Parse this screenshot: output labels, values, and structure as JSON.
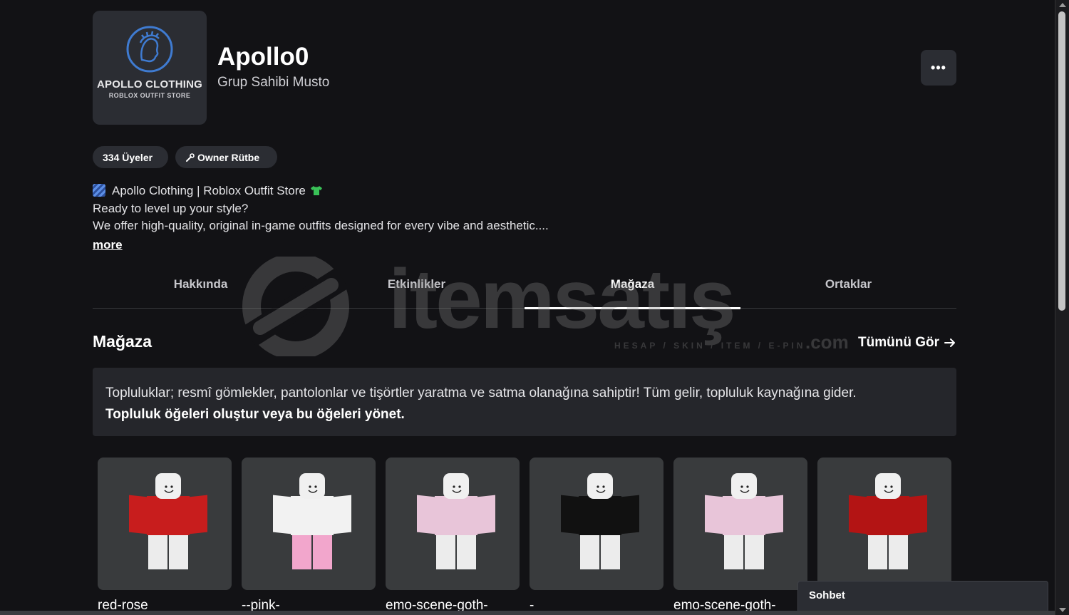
{
  "group": {
    "logo_title": "APOLLO CLOTHING",
    "logo_subtitle": "ROBLOX OUTFIT STORE",
    "name": "Apollo0",
    "owner_prefix": "Grup Sahibi",
    "owner_name": "Musto",
    "more_options_label": "•••",
    "members_label": "334 Üyeler",
    "rank_label": "Owner Rütbe",
    "rank_icon": "wrench-icon"
  },
  "description": {
    "line1": "Apollo Clothing | Roblox Outfit Store",
    "line2": "Ready to level up your style?",
    "line3": "We offer high-quality, original in-game outfits designed for every vibe and aesthetic....",
    "more_label": "more"
  },
  "tabs": [
    {
      "label": "Hakkında",
      "active": false
    },
    {
      "label": "Etkinlikler",
      "active": false
    },
    {
      "label": "Mağaza",
      "active": true
    },
    {
      "label": "Ortaklar",
      "active": false
    }
  ],
  "store": {
    "title": "Mağaza",
    "see_all_label": "Tümünü Gör",
    "info_text": "Topluluklar; resmî gömlekler, pantolonlar ve tişörtler yaratma ve satma olanağına sahiptir! Tüm gelir, topluluk kaynağına gider.",
    "info_link": "Topluluk öğeleri oluştur veya bu öğeleri yönet.",
    "items": [
      {
        "name": "red-rose",
        "shirt_color": "#c81d1d",
        "pants_color": "#ececec"
      },
      {
        "name": "--pink-",
        "shirt_color": "#f2f2f2",
        "pants_color": "#f2a6cc"
      },
      {
        "name": "emo-scene-goth-",
        "shirt_color": "#e8c5d9",
        "pants_color": "#ececec"
      },
      {
        "name": "-",
        "shirt_color": "#111111",
        "pants_color": "#ececec"
      },
      {
        "name": "emo-scene-goth-",
        "shirt_color": "#e8c5d9",
        "pants_color": "#ececec"
      },
      {
        "name": "",
        "shirt_color": "#b31414",
        "pants_color": "#ececec"
      }
    ]
  },
  "watermark": {
    "brand": "itemsatış",
    "tagline": "HESAP / SKIN / ITEM / E-PIN",
    "tld": ".com"
  },
  "chat": {
    "label": "Sohbet"
  }
}
